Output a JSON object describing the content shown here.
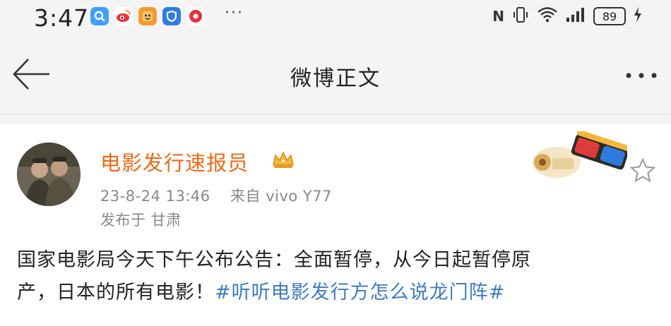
{
  "status_bar": {
    "time": "3:47",
    "dots": "···",
    "nfc": "N",
    "battery": "89",
    "app_icons": [
      "search-app-icon",
      "weibo-app-icon",
      "tiger-app-icon",
      "shield-app-icon",
      "weibo-app-icon-2"
    ],
    "colors": {
      "search": "#3ea0ff",
      "weibo": "#e8323e",
      "tiger": "#f29b2e",
      "shield": "#2f7de1"
    }
  },
  "title_bar": {
    "title": "微博正文"
  },
  "post": {
    "author": "电影发行速报员",
    "timestamp": "23-8-24 13:46",
    "source": "来自 vivo Y77",
    "location": "发布于 甘肃",
    "body_line1": "国家电影局今天下午公布公告：全面暂停，从今日起暂停原",
    "body_line2_prefix": "产，日本的所有电影！",
    "hashtag": "#听听电影发行方怎么说龙门阵#",
    "colors": {
      "author": "#e86b1a",
      "hashtag": "#3f7bbf",
      "meta": "#888888"
    }
  }
}
